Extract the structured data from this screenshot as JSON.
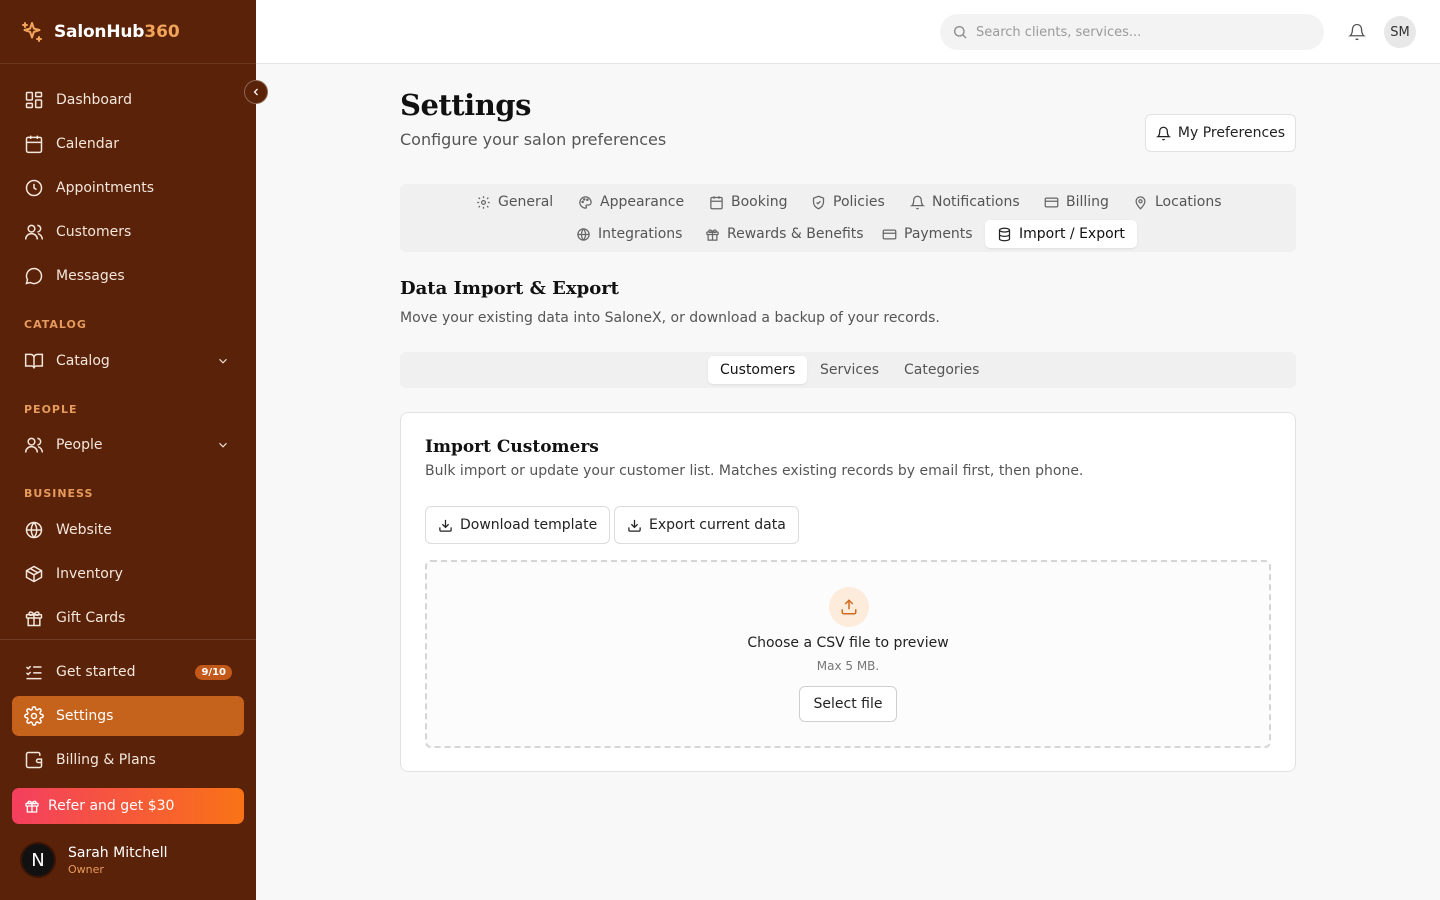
{
  "brand": {
    "name": "SalonHub",
    "accent": "360"
  },
  "sidebar": {
    "items": [
      {
        "label": "Dashboard"
      },
      {
        "label": "Calendar"
      },
      {
        "label": "Appointments"
      },
      {
        "label": "Customers"
      },
      {
        "label": "Messages"
      }
    ],
    "sections": {
      "catalog": {
        "heading": "CATALOG",
        "item": "Catalog"
      },
      "people": {
        "heading": "PEOPLE",
        "item": "People"
      },
      "business": {
        "heading": "BUSINESS",
        "items": [
          "Website",
          "Inventory",
          "Gift Cards"
        ]
      }
    },
    "bottom": {
      "get_started": "Get started",
      "get_started_badge": "9/10",
      "settings": "Settings",
      "billing": "Billing & Plans",
      "refer": "Refer and get $30"
    },
    "user": {
      "initial": "N",
      "name": "Sarah Mitchell",
      "role": "Owner"
    }
  },
  "topbar": {
    "search_placeholder": "Search clients, services...",
    "avatar_initials": "SM"
  },
  "page": {
    "title": "Settings",
    "subtitle": "Configure your salon preferences",
    "preferences_button": "My Preferences"
  },
  "tabs": {
    "general": "General",
    "appearance": "Appearance",
    "booking": "Booking",
    "policies": "Policies",
    "notifications": "Notifications",
    "billing": "Billing",
    "locations": "Locations",
    "integrations": "Integrations",
    "rewards": "Rewards & Benefits",
    "payments": "Payments",
    "import_export": "Import / Export"
  },
  "section": {
    "title": "Data Import & Export",
    "subtitle": "Move your existing data into SaloneX, or download a backup of your records."
  },
  "subtabs": {
    "customers": "Customers",
    "services": "Services",
    "categories": "Categories"
  },
  "card": {
    "title": "Import Customers",
    "subtitle": "Bulk import or update your customer list. Matches existing records by email first, then phone.",
    "download_template": "Download template",
    "export_current": "Export current data",
    "dropzone_title": "Choose a CSV file to preview",
    "dropzone_sub": "Max 5 MB.",
    "select_file": "Select file"
  },
  "colors": {
    "sidebar_bg": "#5a2208",
    "accent": "#c5621b",
    "brand_accent": "#f2a45a",
    "refer_gradient_start": "#f43f5e",
    "refer_gradient_end": "#f97316"
  }
}
